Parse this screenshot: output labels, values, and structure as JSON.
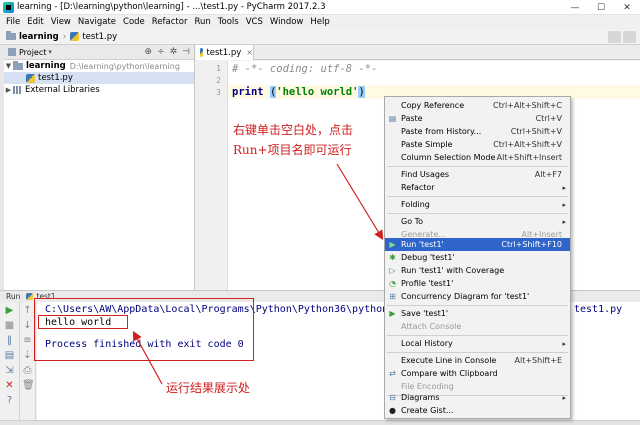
{
  "window": {
    "title": "learning - [D:\\learning\\python\\learning] - ...\\test1.py - PyCharm 2017.2.3",
    "min": "—",
    "max": "☐",
    "close": "✕"
  },
  "menu": [
    "File",
    "Edit",
    "View",
    "Navigate",
    "Code",
    "Refactor",
    "Run",
    "Tools",
    "VCS",
    "Window",
    "Help"
  ],
  "breadcrumb": {
    "project": "learning",
    "file": "test1.py"
  },
  "project_panel": {
    "header": "Project",
    "tools": [
      "⊕",
      "÷",
      "✲",
      "⊣"
    ],
    "root": {
      "name": "learning",
      "path": "D:\\learning\\python\\learning"
    },
    "file": "test1.py",
    "external": "External Libraries"
  },
  "editor": {
    "tab": "test1.py",
    "tab_close": "×",
    "lines": [
      "1",
      "2",
      "3"
    ],
    "code": {
      "line1": "# -*- coding: utf-8 -*-",
      "kw": "print",
      "open": "(",
      "str": "'hello world'",
      "close": ")"
    }
  },
  "annotations": {
    "right_click": "右键单击空白处，点击Run+项目名即可运行",
    "result": "运行结果展示处"
  },
  "run_window": {
    "title": "Run",
    "config": "test1",
    "console": {
      "path": "C:\\Users\\AW\\AppData\\Local\\Programs\\Python\\Python36\\python.",
      "path_tail": "test1.py",
      "output": "hello world",
      "exit": "Process finished with exit code 0"
    }
  },
  "context_menu": [
    {
      "label": "Copy Reference",
      "shortcut": "Ctrl+Alt+Shift+C"
    },
    {
      "label": "Paste",
      "shortcut": "Ctrl+V",
      "icon": "▤"
    },
    {
      "label": "Paste from History...",
      "shortcut": "Ctrl+Shift+V"
    },
    {
      "label": "Paste Simple",
      "shortcut": "Ctrl+Alt+Shift+V"
    },
    {
      "label": "Column Selection Mode",
      "shortcut": "Alt+Shift+Insert"
    },
    {
      "label": "Find Usages",
      "shortcut": "Alt+F7"
    },
    {
      "label": "Refactor",
      "arrow": "▸"
    },
    {
      "label": "Folding",
      "arrow": "▸"
    },
    {
      "label": "Go To",
      "arrow": "▸"
    },
    {
      "label": "Generate...",
      "shortcut": "Alt+Insert"
    },
    {
      "label": "Run 'test1'",
      "shortcut": "Ctrl+Shift+F10",
      "icon": "▶"
    },
    {
      "label": "Debug 'test1'",
      "icon": "✱"
    },
    {
      "label": "Run 'test1' with Coverage",
      "icon": "▷"
    },
    {
      "label": "Profile 'test1'",
      "icon": "◔"
    },
    {
      "label": "Concurrency Diagram for  'test1'",
      "icon": "⊞"
    },
    {
      "label": "Save 'test1'",
      "icon": "▶"
    },
    {
      "label": "Attach Console"
    },
    {
      "label": "Local History",
      "arrow": "▸"
    },
    {
      "label": "Execute Line in Console",
      "shortcut": "Alt+Shift+E"
    },
    {
      "label": "Compare with Clipboard",
      "icon": "⇄"
    },
    {
      "label": "File Encoding"
    },
    {
      "label": "Diagrams",
      "arrow": "▸",
      "icon": "⊟"
    },
    {
      "label": "Create Gist...",
      "icon": "●"
    }
  ],
  "colors": {
    "accent_highlight": "#2f65ca",
    "annotation": "#d02020",
    "run_green": "#3c9c3c"
  }
}
